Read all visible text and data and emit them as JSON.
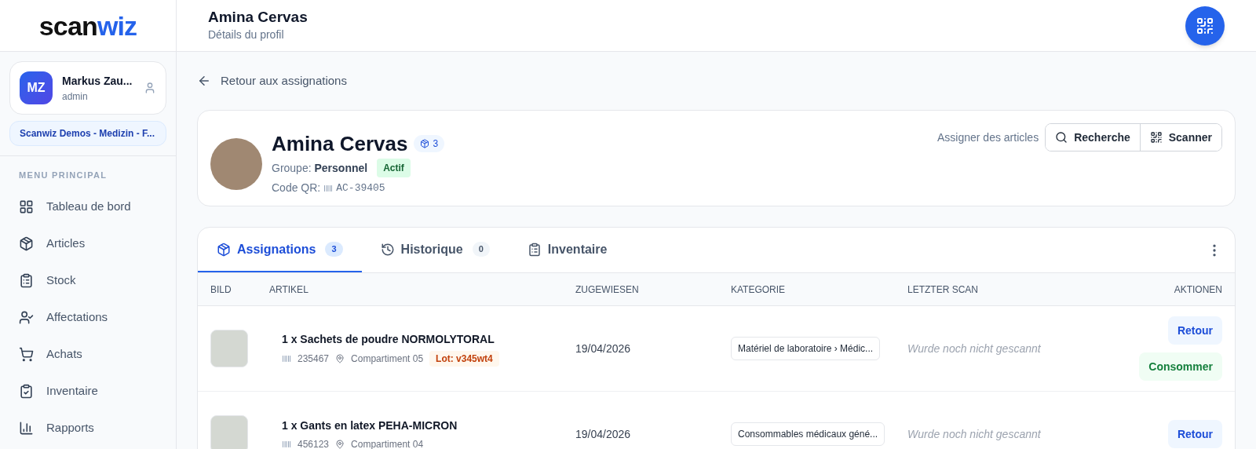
{
  "logo": {
    "part_1": "scan",
    "part_2": "wiz"
  },
  "user": {
    "initials": "MZ",
    "name": "Markus Zau...",
    "role": "admin",
    "organization": "Scanwiz Demos - Medizin - F..."
  },
  "sidebar": {
    "section_title": "MENU PRINCIPAL",
    "items": [
      {
        "label": "Tableau de bord",
        "kind": "dashboard"
      },
      {
        "label": "Articles",
        "kind": "package"
      },
      {
        "label": "Stock",
        "kind": "clipboard-list"
      },
      {
        "label": "Affectations",
        "kind": "user-check"
      },
      {
        "label": "Achats",
        "kind": "cart"
      },
      {
        "label": "Inventaire",
        "kind": "clipboard-check"
      },
      {
        "label": "Rapports",
        "kind": "chart"
      }
    ]
  },
  "header": {
    "title": "Amina Cervas",
    "subtitle": "Détails du profil"
  },
  "back_link": "Retour aux assignations",
  "profile": {
    "name": "Amina Cervas",
    "item_count": "3",
    "group_label": "Groupe:",
    "group": "Personnel",
    "status": "Actif",
    "qr_label": "Code QR:",
    "qr_code": "AC-39405",
    "assign_label": "Assigner des articles",
    "buttons": [
      {
        "label": "Recherche",
        "kind": "search"
      },
      {
        "label": "Scanner",
        "kind": "qr"
      }
    ]
  },
  "tabs": [
    {
      "label": "Assignations",
      "count": "3",
      "kind": "package",
      "selected": true
    },
    {
      "label": "Historique",
      "count": "0",
      "kind": "history",
      "selected": false
    },
    {
      "label": "Inventaire",
      "kind": "clipboard-list",
      "selected": false
    }
  ],
  "table": {
    "columns": [
      "BILD",
      "ARTIKEL",
      "ZUGEWIESEN",
      "KATEGORIE",
      "LETZTER SCAN",
      "AKTIONEN"
    ],
    "rows": [
      {
        "article": "1 x Sachets de poudre NORMOLYTORAL",
        "code": "235467",
        "location": "Compartiment 05",
        "lot": "Lot: v345wt4",
        "assigned": "19/04/2026",
        "category": "Matériel de laboratoire › Médic...",
        "last_scan": "Wurde noch nicht gescannt",
        "actions": [
          {
            "label": "Retour",
            "kind": "return"
          },
          {
            "label": "Consommer",
            "kind": "consume"
          }
        ]
      },
      {
        "article": "1 x Gants en latex PEHA-MICRON",
        "code": "456123",
        "location": "Compartiment 04",
        "assigned": "19/04/2026",
        "category": "Consommables médicaux géné...",
        "last_scan": "Wurde noch nicht gescannt",
        "actions": [
          {
            "label": "Retour",
            "kind": "return"
          }
        ]
      }
    ]
  }
}
